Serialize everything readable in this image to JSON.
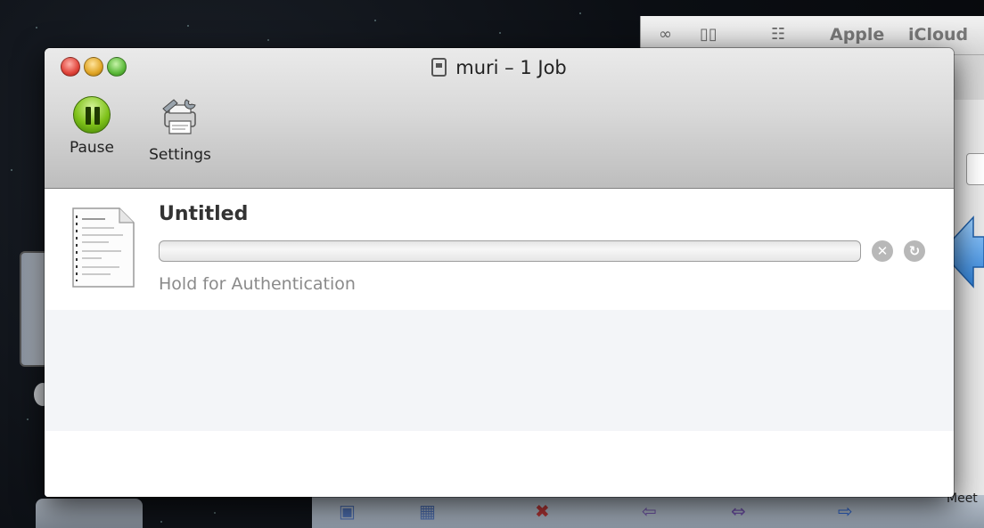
{
  "window": {
    "title": "muri – 1 Job"
  },
  "toolbar": {
    "pause_label": "Pause",
    "settings_label": "Settings"
  },
  "jobs": [
    {
      "name": "Untitled",
      "status": "Hold for Authentication",
      "progress": 0
    }
  ],
  "background_window": {
    "toolbar_items": [
      "Apple",
      "iCloud"
    ],
    "bottom_text": "Meet"
  },
  "colors": {
    "pause_green": "#7fc21a",
    "annotation_arrow": "#4a9ee8",
    "status_gray": "#8a8a8a"
  },
  "icons": {
    "reading_list": "glasses-icon",
    "bookmarks": "book-icon",
    "top_sites": "grid-icon",
    "delete_job": "delete-icon",
    "resume_job": "resume-icon",
    "document": "document-icon",
    "printer_settings": "printer-settings-icon"
  }
}
